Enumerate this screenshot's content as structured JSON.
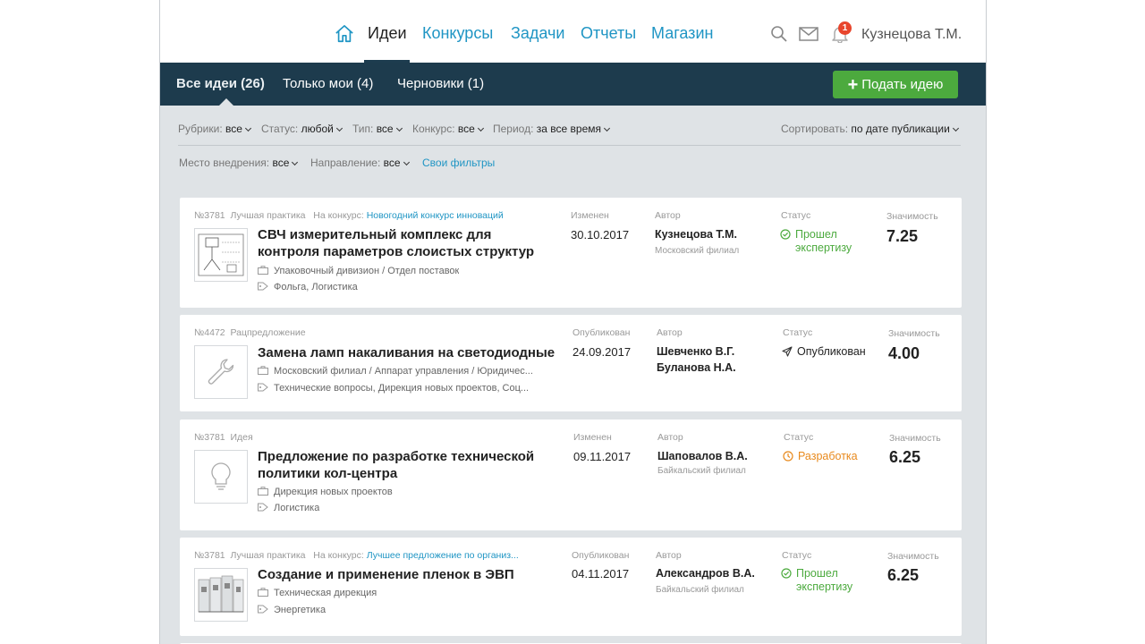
{
  "nav": {
    "items": [
      "Идеи",
      "Конкурсы",
      "Задачи",
      "Отчеты",
      "Магазин"
    ],
    "notification_count": "1",
    "user_name": "Кузнецова Т.М."
  },
  "subnav": {
    "tabs": [
      "Все идеи (26)",
      "Только мои (4)",
      "Черновики (1)"
    ],
    "submit_label": "Подать идею",
    "submit_icon": "plus-icon"
  },
  "filters": {
    "rubric": {
      "label": "Рубрики:",
      "value": "все"
    },
    "status": {
      "label": "Статус:",
      "value": "любой"
    },
    "type": {
      "label": "Тип:",
      "value": "все"
    },
    "contest": {
      "label": "Конкурс:",
      "value": "все"
    },
    "period": {
      "label": "Период:",
      "value": "за все время"
    },
    "sort": {
      "label": "Сортировать:",
      "value": "по дате публикации"
    },
    "place": {
      "label": "Место внедрения:",
      "value": "все"
    },
    "direction": {
      "label": "Направление:",
      "value": "все"
    },
    "own_filters": "Свои фильтры"
  },
  "labels": {
    "author": "Автор",
    "status": "Статус",
    "score": "Значимость"
  },
  "colors": {
    "status_ok": "#4caa3e",
    "status_dev": "#e8891c",
    "accent": "#1f95c4",
    "header_dark": "#1d3b4d"
  },
  "ideas": [
    {
      "number": "№3781",
      "type": "Лучшая практика",
      "contest_prefix": "На конкурс:",
      "contest_name": "Новогодний конкурс инноваций",
      "title": "СВЧ измерительный комплекс для контроля параметров слоистых структур",
      "dept": "Упаковочный дивизион / Отдел поставок",
      "tags": "Фольга, Логистика",
      "date_label": "Изменен",
      "date": "30.10.2017",
      "author": "Кузнецова Т.М.",
      "author_sub": "Московский филиал",
      "status": "Прошел экспертизу",
      "status_icon": "check-circle-icon",
      "score": "7.25"
    },
    {
      "number": "№4472",
      "type": "Рацпредложение",
      "title": "Замена ламп накаливания на светодиодные",
      "dept": "Московский филиал / Аппарат управления / Юридичес...",
      "tags": "Технические вопросы, Дирекция новых проектов, Соц...",
      "date_label": "Опубликован",
      "date": "24.09.2017",
      "author": "Шевченко В.Г.",
      "author2": "Буланова Н.А.",
      "status": "Опубликован",
      "status_icon": "paper-plane-icon",
      "score": "4.00"
    },
    {
      "number": "№3781",
      "type": "Идея",
      "title": "Предложение по разработке технической политики кол-центра",
      "dept": "Дирекция новых проектов",
      "tags": "Логистика",
      "date_label": "Изменен",
      "date": "09.11.2017",
      "author": "Шаповалов В.А.",
      "author_sub": "Байкальский филиал",
      "status": "Разработка",
      "status_icon": "clock-icon",
      "score": "6.25"
    },
    {
      "number": "№3781",
      "type": "Лучшая практика",
      "contest_prefix": "На конкурс:",
      "contest_name": "Лучшее предложение по организ...",
      "title": "Создание и применение пленок в ЭВП",
      "dept": "Техническая дирекция",
      "tags": "Энергетика",
      "date_label": "Опубликован",
      "date": "04.11.2017",
      "author": "Александров В.А.",
      "author_sub": "Байкальский филиал",
      "status": "Прошел экспертизу",
      "status_icon": "check-circle-icon",
      "score": "6.25"
    }
  ]
}
